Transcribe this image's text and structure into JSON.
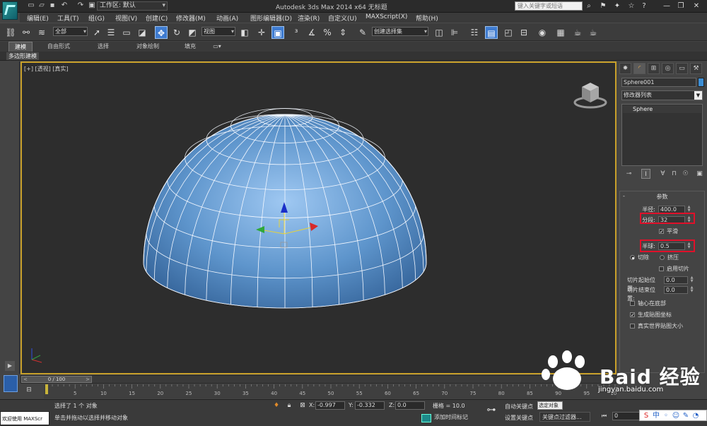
{
  "titlebar": {
    "workspace": "工作区: 默认",
    "title": "Autodesk 3ds Max  2014 x64      无标题",
    "search_placeholder": "键入关键字或短语",
    "icons": [
      "new-icon",
      "open-icon",
      "save-icon",
      "undo-icon",
      "redo-icon",
      "project-icon"
    ]
  },
  "menu": [
    "编辑(E)",
    "工具(T)",
    "组(G)",
    "视图(V)",
    "创建(C)",
    "修改器(M)",
    "动画(A)",
    "图形编辑器(D)",
    "渲染(R)",
    "自定义(U)",
    "MAXScript(X)",
    "帮助(H)"
  ],
  "toolbar": {
    "filter_value": "全部",
    "ref_coord_value": "视图",
    "named_sel_value": "创建选择集"
  },
  "ribbon": {
    "tabs": [
      "建模",
      "自由形式",
      "选择",
      "对象绘制",
      "填充"
    ],
    "sub_label": "多边形建模"
  },
  "viewport": {
    "label": "[+] [透视] [真实]",
    "sphere_color": "#6ea6dc",
    "border_color": "#c8a02a"
  },
  "command_panel": {
    "object_name": "Sphere001",
    "object_color": "#3d8fd6",
    "modifier_list": "修改器列表",
    "stack_item": "Sphere",
    "rollout_title": "参数",
    "params": {
      "radius_label": "半径:",
      "radius_value": "400.0",
      "segments_label": "分段:",
      "segments_value": "32",
      "smooth_label": "平滑",
      "hemisphere_label": "半球:",
      "hemisphere_value": "0.5",
      "chop_label": "切除",
      "squash_label": "挤压",
      "enable_slice_label": "启用切片",
      "slice_from_label": "切片起始位置:",
      "slice_from_value": "0.0",
      "slice_to_label": "切片结束位置:",
      "slice_to_value": "0.0",
      "base_to_pivot_label": "轴心在底部",
      "gen_mapping_label": "生成贴图坐标",
      "real_world_label": "真实世界贴图大小"
    }
  },
  "timeline": {
    "slider_text": "0 / 100",
    "ticks": [
      "5",
      "10",
      "15",
      "20",
      "25",
      "30",
      "35",
      "40",
      "45",
      "50",
      "55",
      "60",
      "65",
      "70",
      "75",
      "80",
      "85",
      "90",
      "95",
      "100"
    ]
  },
  "status": {
    "listener": "欢迎使用 MAXScr",
    "line1": "选择了 1 个 对象",
    "line2": "单击并拖动以选择并移动对象",
    "x_label": "X:",
    "x_value": "-0.997",
    "y_label": "Y:",
    "y_value": "-0.332",
    "z_label": "Z:",
    "z_value": "0.0",
    "grid": "栅格 = 10.0",
    "add_tag": "添加时间标记",
    "auto_key": "自动关键点",
    "key_mode": "选定对象",
    "set_key": "设置关键点",
    "key_filters": "关键点过滤器...",
    "frame_value": "0"
  },
  "watermark": {
    "text": "Baid 经验",
    "sub": "jingyan.baidu.com"
  }
}
